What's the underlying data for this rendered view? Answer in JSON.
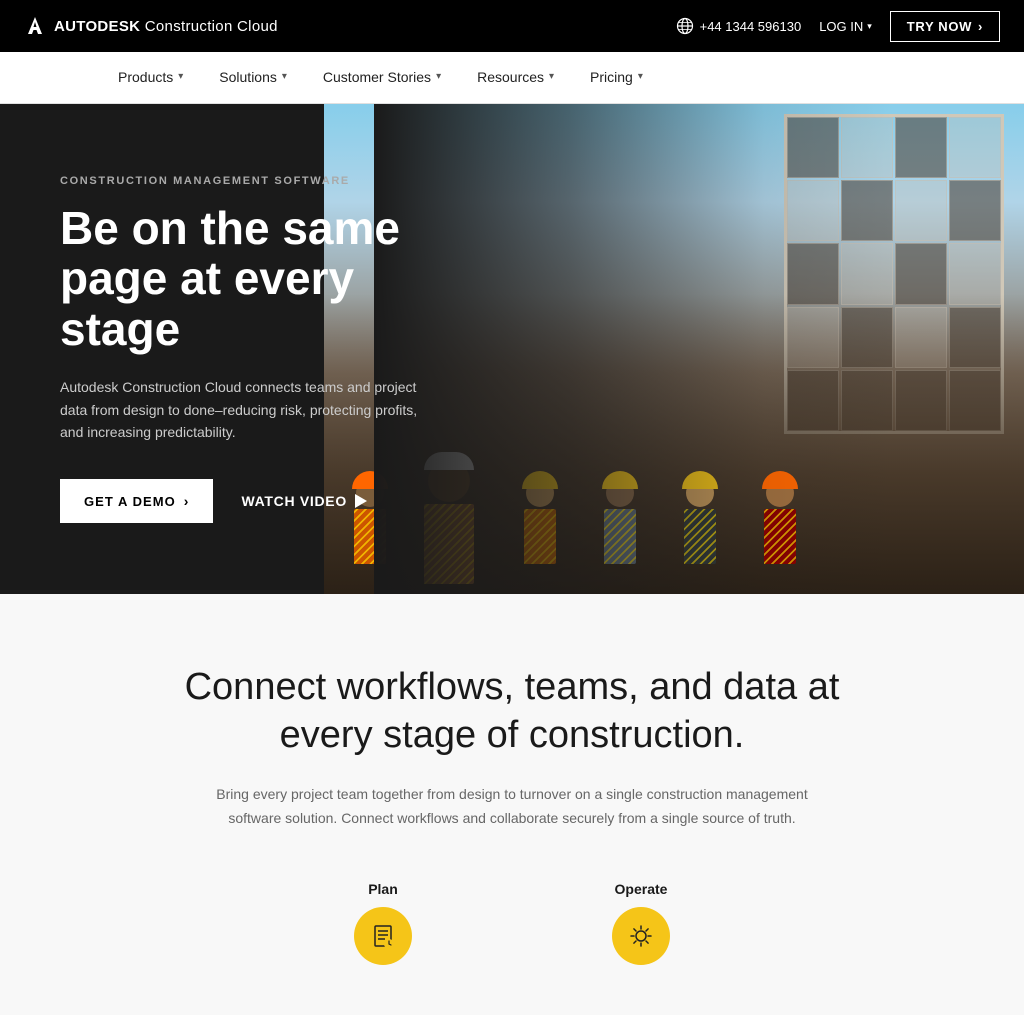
{
  "topbar": {
    "logo_text_bold": "AUTODESK",
    "logo_text_light": " Construction Cloud",
    "phone": "+44 1344 596130",
    "login_label": "LOG IN",
    "try_label": "TRY NOW"
  },
  "nav": {
    "items": [
      {
        "label": "Products",
        "has_dropdown": true
      },
      {
        "label": "Solutions",
        "has_dropdown": true
      },
      {
        "label": "Customer Stories",
        "has_dropdown": true
      },
      {
        "label": "Resources",
        "has_dropdown": true
      },
      {
        "label": "Pricing",
        "has_dropdown": true
      }
    ]
  },
  "hero": {
    "label": "CONSTRUCTION MANAGEMENT SOFTWARE",
    "title": "Be on the same page at every stage",
    "description": "Autodesk Construction Cloud connects teams and project data from design to done–reducing risk, protecting profits, and increasing predictability.",
    "cta_demo": "GET A DEMO",
    "cta_watch": "WATCH VIDEO"
  },
  "section": {
    "title": "Connect workflows, teams, and data at every stage of construction.",
    "description": "Bring every project team together from design to turnover on a single construction management software solution. Connect workflows and collaborate securely from a single source of truth.",
    "icons": [
      {
        "label": "Plan"
      },
      {
        "label": "Operate"
      }
    ]
  }
}
